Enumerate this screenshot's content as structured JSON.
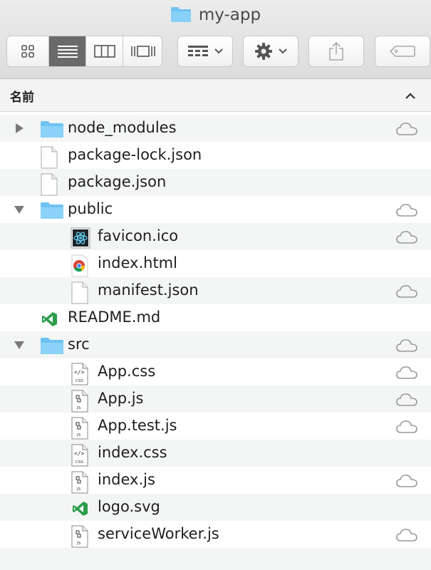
{
  "window": {
    "title": "my-app"
  },
  "toolbar": {
    "view_buttons": [
      {
        "icon": "icon-view-icon",
        "active": false
      },
      {
        "icon": "list-view-icon",
        "active": true
      },
      {
        "icon": "column-view-icon",
        "active": false
      },
      {
        "icon": "gallery-view-icon",
        "active": false
      }
    ],
    "group_button_icon": "group-by-icon",
    "action_button_icon": "gear-icon",
    "share_button_icon": "share-icon",
    "tag_button_icon": "tag-icon"
  },
  "header": {
    "name_column": "名前",
    "sort": "ascending"
  },
  "files": [
    {
      "name": "node_modules",
      "type": "folder",
      "depth": 0,
      "disclosure": "collapsed",
      "cloud": true
    },
    {
      "name": "package-lock.json",
      "type": "document",
      "depth": 0,
      "disclosure": "none",
      "cloud": false
    },
    {
      "name": "package.json",
      "type": "document",
      "depth": 0,
      "disclosure": "none",
      "cloud": false
    },
    {
      "name": "public",
      "type": "folder",
      "depth": 0,
      "disclosure": "expanded",
      "cloud": true
    },
    {
      "name": "favicon.ico",
      "type": "react-image",
      "depth": 1,
      "disclosure": "none",
      "cloud": true
    },
    {
      "name": "index.html",
      "type": "chrome-html",
      "depth": 1,
      "disclosure": "none",
      "cloud": false
    },
    {
      "name": "manifest.json",
      "type": "document",
      "depth": 1,
      "disclosure": "none",
      "cloud": true
    },
    {
      "name": "README.md",
      "type": "vscode",
      "depth": 0,
      "disclosure": "none",
      "cloud": false
    },
    {
      "name": "src",
      "type": "folder",
      "depth": 0,
      "disclosure": "expanded",
      "cloud": true
    },
    {
      "name": "App.css",
      "type": "css",
      "depth": 1,
      "disclosure": "none",
      "cloud": true
    },
    {
      "name": "App.js",
      "type": "js",
      "depth": 1,
      "disclosure": "none",
      "cloud": true
    },
    {
      "name": "App.test.js",
      "type": "js",
      "depth": 1,
      "disclosure": "none",
      "cloud": true
    },
    {
      "name": "index.css",
      "type": "css",
      "depth": 1,
      "disclosure": "none",
      "cloud": false
    },
    {
      "name": "index.js",
      "type": "js",
      "depth": 1,
      "disclosure": "none",
      "cloud": true
    },
    {
      "name": "logo.svg",
      "type": "vscode",
      "depth": 1,
      "disclosure": "none",
      "cloud": false
    },
    {
      "name": "serviceWorker.js",
      "type": "js",
      "depth": 1,
      "disclosure": "none",
      "cloud": true
    }
  ],
  "colors": {
    "folder": "#6fc3f2",
    "row_alt": "#f4f5f5",
    "active_view": "#6a6a6a"
  }
}
